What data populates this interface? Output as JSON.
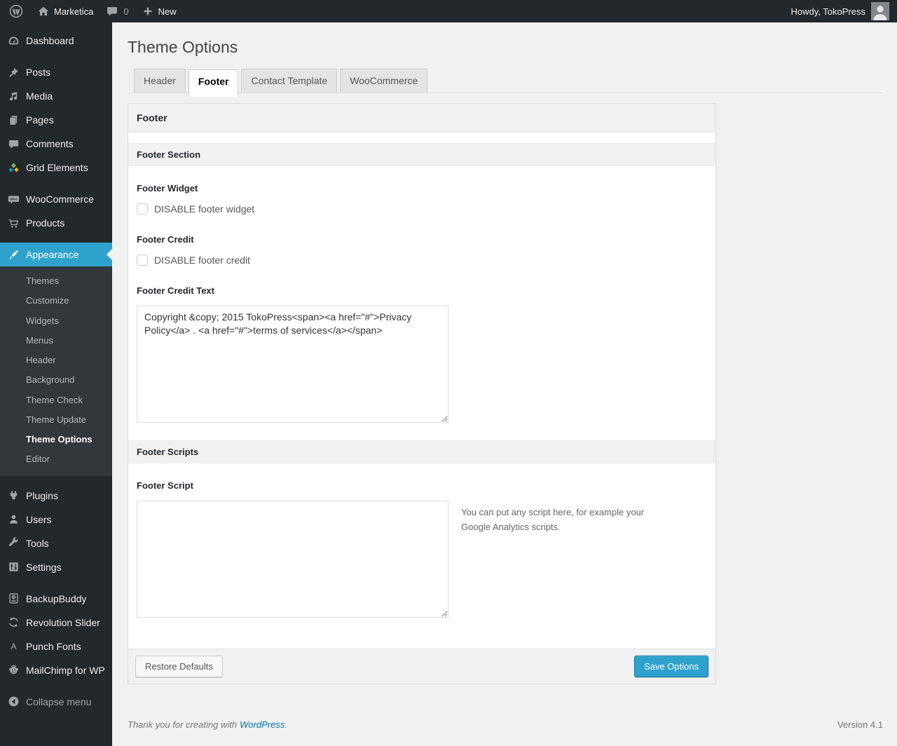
{
  "admin_bar": {
    "site_name": "Marketica",
    "comment_count": "0",
    "new_label": "New",
    "howdy": "Howdy, TokoPress"
  },
  "sidebar": {
    "groups": [
      {
        "items": [
          {
            "icon": "dashboard-icon",
            "label": "Dashboard"
          }
        ]
      },
      {
        "items": [
          {
            "icon": "pushpin-icon",
            "label": "Posts"
          },
          {
            "icon": "media-icon",
            "label": "Media"
          },
          {
            "icon": "pages-icon",
            "label": "Pages"
          },
          {
            "icon": "comments-icon",
            "label": "Comments"
          },
          {
            "icon": "grid-elements-icon",
            "label": "Grid Elements"
          }
        ]
      },
      {
        "items": [
          {
            "icon": "woocommerce-icon",
            "label": "WooCommerce"
          },
          {
            "icon": "cart-icon",
            "label": "Products"
          }
        ]
      },
      {
        "items": [
          {
            "icon": "paintbrush-icon",
            "label": "Appearance",
            "active": true,
            "submenu": [
              "Themes",
              "Customize",
              "Widgets",
              "Menus",
              "Header",
              "Background",
              "Theme Check",
              "Theme Update",
              "Theme Options",
              "Editor"
            ],
            "current_submenu": "Theme Options"
          }
        ]
      },
      {
        "items": [
          {
            "icon": "plugin-icon",
            "label": "Plugins"
          },
          {
            "icon": "users-icon",
            "label": "Users"
          },
          {
            "icon": "wrench-icon",
            "label": "Tools"
          },
          {
            "icon": "settings-icon",
            "label": "Settings"
          }
        ]
      },
      {
        "items": [
          {
            "icon": "backupbuddy-icon",
            "label": "BackupBuddy"
          },
          {
            "icon": "revolution-slider-icon",
            "label": "Revolution Slider"
          },
          {
            "icon": "punch-fonts-icon",
            "label": "Punch Fonts"
          },
          {
            "icon": "mailchimp-icon",
            "label": "MailChimp for WP"
          }
        ]
      },
      {
        "items": [
          {
            "icon": "collapse-icon",
            "label": "Collapse menu",
            "dim": true
          }
        ]
      }
    ]
  },
  "page": {
    "title": "Theme Options"
  },
  "tabs": [
    {
      "label": "Header"
    },
    {
      "label": "Footer",
      "active": true
    },
    {
      "label": "Contact Template"
    },
    {
      "label": "WooCommerce"
    }
  ],
  "panel": {
    "title": "Footer",
    "footer_section": {
      "title": "Footer Section",
      "footer_widget": {
        "label": "Footer Widget",
        "checkbox_label": "DISABLE footer widget",
        "checked": false
      },
      "footer_credit": {
        "label": "Footer Credit",
        "checkbox_label": "DISABLE footer credit",
        "checked": false
      },
      "footer_credit_text": {
        "label": "Footer Credit Text",
        "value": "Copyright &copy; 2015 TokoPress<span><a href=\"#\">Privacy Policy</a> . <a href=\"#\">terms of services</a></span>"
      }
    },
    "footer_scripts": {
      "title": "Footer Scripts",
      "footer_script": {
        "label": "Footer Script",
        "value": "",
        "hint": "You can put any script here, for example your Google Analytics scripts."
      }
    },
    "actions": {
      "restore_label": "Restore Defaults",
      "save_label": "Save Options"
    }
  },
  "page_footer": {
    "thanks_text": "Thank you for creating with",
    "wordpress_link": "WordPress",
    "period": ".",
    "version": "Version 4.1"
  },
  "colors": {
    "admin_bar_bg": "#23282d",
    "menu_highlight": "#2ea2cc",
    "content_bg": "#f1f1f1",
    "primary_button": "#2ea2cc",
    "link_blue": "#0073aa"
  }
}
